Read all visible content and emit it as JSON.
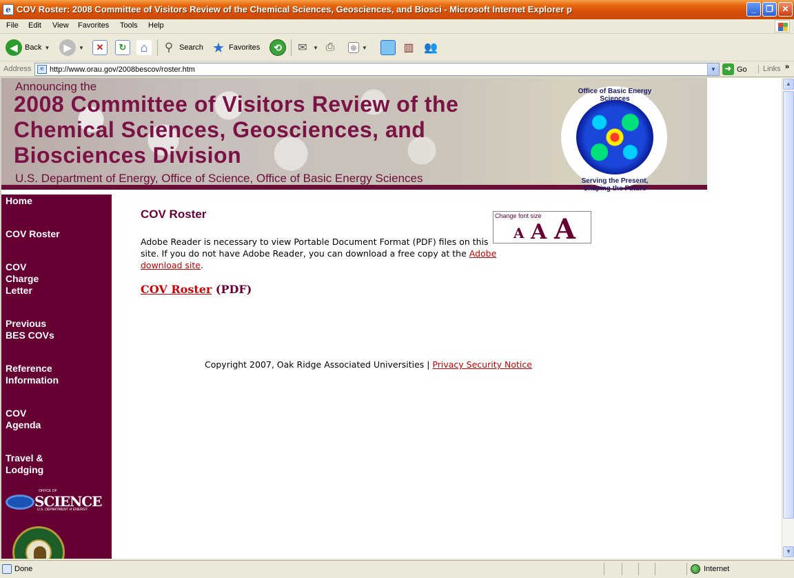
{
  "window": {
    "title": "COV Roster: 2008 Committee of Visitors Review of the Chemical Sciences, Geosciences, and Biosci - Microsoft Internet Explorer p",
    "minimize": "_",
    "maximize": "❐",
    "close": "✕"
  },
  "menu": [
    "File",
    "Edit",
    "View",
    "Favorites",
    "Tools",
    "Help"
  ],
  "toolbar": {
    "back": "Back",
    "search": "Search",
    "favorites": "Favorites"
  },
  "address": {
    "label": "Address",
    "url": "http://www.orau.gov/2008bescov/roster.htm",
    "go": "Go",
    "links": "Links"
  },
  "banner": {
    "announcing": "Announcing the",
    "headline": "2008 Committee of Visitors Review of the Chemical Sciences, Geosciences, and Biosciences Division",
    "subline": "U.S. Department of Energy, Office of Science, Office of Basic Energy Sciences",
    "seal_top": "Office of Basic Energy Sciences",
    "seal_bottom": "Serving the Present, Shaping the Future"
  },
  "sidebar": {
    "items": [
      {
        "label": "Home"
      },
      {
        "label": "COV Roster"
      },
      {
        "label": "COV Charge Letter"
      },
      {
        "label": "Previous BES COVs"
      },
      {
        "label": "Reference Information"
      },
      {
        "label": "COV Agenda"
      },
      {
        "label": "Travel & Lodging"
      }
    ],
    "science_logo": {
      "office": "OFFICE OF",
      "word": "SCIENCE",
      "doe": "U.S. DEPARTMENT of ENERGY"
    }
  },
  "main": {
    "title": "COV Roster",
    "intro": "Adobe Reader is necessary to view Portable Document Format (PDF) files on this site. If you do not have Adobe Reader, you can download a free copy at the ",
    "adobe_link": "Adobe download site",
    "intro_end": ".",
    "roster_link": "COV Roster",
    "roster_suffix": " (PDF)",
    "font_box_label": "Change font size",
    "font_sizes": [
      "A",
      "A",
      "A"
    ]
  },
  "footer": {
    "copyright": "Copyright 2007, Oak Ridge Associated Universities | ",
    "privacy_link": "Privacy Security Notice"
  },
  "status": {
    "text": "Done",
    "zone": "Internet"
  },
  "colors": {
    "brand": "#660033",
    "link": "#cc0000",
    "titlebar": "#e86a10"
  }
}
